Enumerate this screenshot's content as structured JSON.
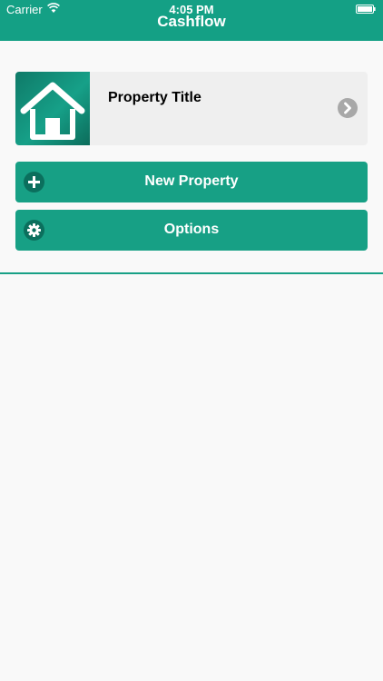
{
  "status_bar": {
    "carrier": "Carrier",
    "time": "4:05 PM"
  },
  "header": {
    "title": "Cashflow"
  },
  "property_card": {
    "title": "Property Title",
    "thumbnail_icon": "house-icon",
    "action_icon": "chevron-right-icon"
  },
  "buttons": {
    "new_property": {
      "label": "New Property",
      "icon": "plus-icon"
    },
    "options": {
      "label": "Options",
      "icon": "gear-icon"
    }
  },
  "colors": {
    "accent": "#17a085",
    "card_background": "#efefef",
    "page_background": "#f9f9f9",
    "chevron_gray": "#a8a8a8"
  }
}
